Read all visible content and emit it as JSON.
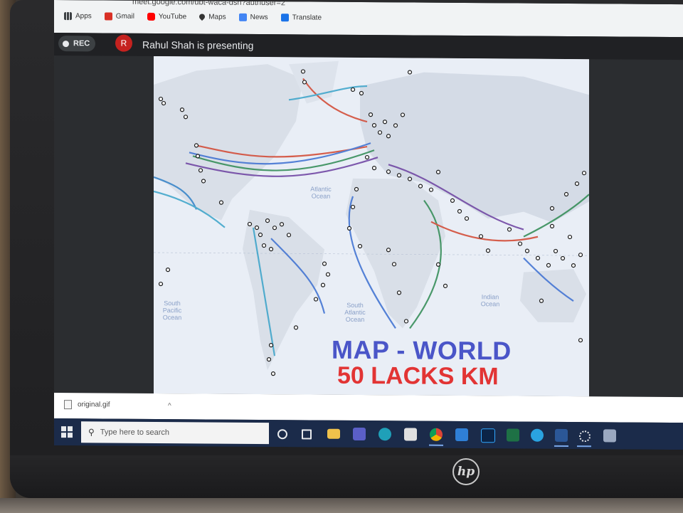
{
  "browser": {
    "url": "meet.google.com/ubt-waca-dsn?authuser=2",
    "bookmarks": [
      {
        "label": "Apps",
        "icon": "apps-grid-icon",
        "color": "#3c4043"
      },
      {
        "label": "Gmail",
        "icon": "gmail-icon",
        "color": "#d93025"
      },
      {
        "label": "YouTube",
        "icon": "youtube-icon",
        "color": "#ff0000"
      },
      {
        "label": "Maps",
        "icon": "maps-pin-icon",
        "color": "#1a73e8"
      },
      {
        "label": "News",
        "icon": "news-icon",
        "color": "#4285f4"
      },
      {
        "label": "Translate",
        "icon": "translate-icon",
        "color": "#1a73e8"
      }
    ]
  },
  "meet": {
    "rec_label": "REC",
    "avatar_initial": "R",
    "presenting_text": "Rahul Shah is presenting"
  },
  "slide": {
    "title": "MAP - WORLD",
    "subtitle": "50 LACKS KM",
    "title_color": "#4a55c8",
    "subtitle_color": "#e23434",
    "oceans": {
      "atlantic": "Atlantic Ocean",
      "south_pacific": "South Pacific Ocean",
      "south_atlantic": "South Atlantic Ocean",
      "indian": "Indian Ocean"
    }
  },
  "download": {
    "filename": "original.gif",
    "chevron": "^"
  },
  "taskbar": {
    "search_placeholder": "Type here to search",
    "apps": [
      "cortana-icon",
      "task-view-icon",
      "file-explorer-icon",
      "teams-icon",
      "edge-icon",
      "store-icon",
      "chrome-icon",
      "mail-icon",
      "photoshop-icon",
      "excel-icon",
      "telegram-icon",
      "word-icon",
      "settings-icon",
      "network-icon"
    ]
  },
  "device": {
    "brand": "hp"
  }
}
